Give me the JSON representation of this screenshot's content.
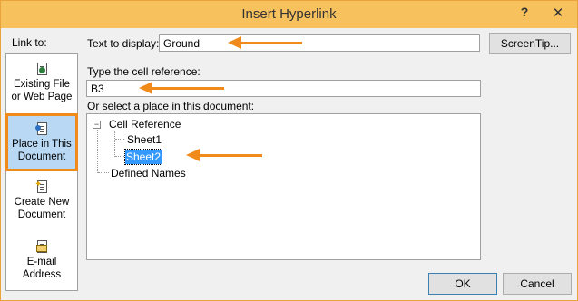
{
  "window": {
    "title": "Insert Hyperlink",
    "help": "?",
    "close": "✕"
  },
  "link_to": {
    "label": "Link to:",
    "items": [
      {
        "line1": "Existing File",
        "line2": "or Web Page",
        "icon": "web-page-icon"
      },
      {
        "line1": "Place in This",
        "line2": "Document",
        "icon": "place-in-document-icon",
        "selected": true
      },
      {
        "line1": "Create New",
        "line2": "Document",
        "icon": "new-document-icon"
      },
      {
        "line1": "E-mail",
        "line2": "Address",
        "icon": "email-icon"
      }
    ]
  },
  "text_to_display": {
    "label": "Text to display:",
    "value": "Ground"
  },
  "screentip_button": "ScreenTip...",
  "cell_reference": {
    "label": "Type the cell reference:",
    "value": "B3"
  },
  "place_list": {
    "label": "Or select a place in this document:",
    "root": "Cell Reference",
    "expander": "−",
    "sheets": [
      "Sheet1",
      "Sheet2"
    ],
    "selected": "Sheet2",
    "defined_names": "Defined Names"
  },
  "buttons": {
    "ok": "OK",
    "cancel": "Cancel"
  },
  "colors": {
    "titlebar": "#f7c25e",
    "annotation_arrow": "#f08a1a",
    "selection": "#3399ff"
  }
}
